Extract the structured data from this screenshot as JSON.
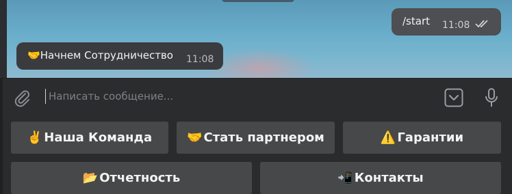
{
  "messages": {
    "outgoing": {
      "text": "/start",
      "time": "11:08"
    },
    "incoming": {
      "emoji": "🤝",
      "text": "Начнем Сотрудничество",
      "time": "11:08"
    }
  },
  "composer": {
    "placeholder": "Написать сообщение..."
  },
  "icons": {
    "attach": "paperclip-icon",
    "keyboard": "keyboard-toggle-icon",
    "mic": "microphone-icon",
    "read_receipt": "double-check-icon"
  },
  "keyboard": {
    "row1": [
      {
        "emoji": "✌️",
        "label": "Наша Команда"
      },
      {
        "emoji": "🤝",
        "label": "Стать партнером"
      },
      {
        "emoji": "⚠️",
        "label": "Гарантии"
      }
    ],
    "row2": [
      {
        "emoji": "📂",
        "label": "Отчетность"
      },
      {
        "emoji": "📲",
        "label": "Контакты"
      }
    ]
  },
  "colors": {
    "chat_background": "#6aaecb",
    "panel": "#2b2c2e",
    "button": "#474849",
    "bubble_in": "#3a3b3e",
    "bubble_out": "#4d4f52"
  }
}
